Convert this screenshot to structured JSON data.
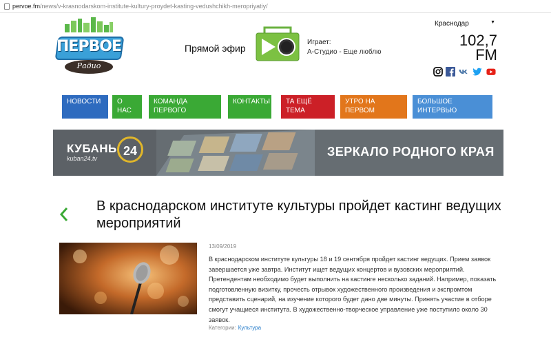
{
  "browser": {
    "host": "pervoe.fm",
    "path": "/news/v-krasnodarskom-institute-kultury-proydet-kasting-vedushchikh-meropriyatiy/"
  },
  "logo": {
    "brand": "ПЕРВОЕ",
    "sub": "Радио"
  },
  "live": {
    "label": "Прямой эфир"
  },
  "now_playing": {
    "label": "Играет:",
    "track": "А-Студио - Еще люблю"
  },
  "city": {
    "selected": "Краснодар"
  },
  "frequency": {
    "value": "102,7",
    "unit": "FM"
  },
  "socials": [
    {
      "icon": "instagram-icon"
    },
    {
      "icon": "facebook-icon"
    },
    {
      "icon": "vk-icon"
    },
    {
      "icon": "twitter-icon"
    },
    {
      "icon": "youtube-icon"
    }
  ],
  "nav": [
    {
      "label": "НОВОСТИ",
      "color": "#2e6bbf"
    },
    {
      "label": "О НАС",
      "color": "#3aa935"
    },
    {
      "label": "КОМАНДА ПЕРВОГО",
      "color": "#3aa935"
    },
    {
      "label": "КОНТАКТЫ",
      "color": "#3aa935"
    },
    {
      "label": "ТА ЕЩЁ ТЕМА",
      "color": "#cc2027"
    },
    {
      "label": "УТРО НА ПЕРВОМ",
      "color": "#e2761b"
    },
    {
      "label": "БОЛЬШОЕ ИНТЕРВЬЮ",
      "color": "#4a8fd6"
    }
  ],
  "banner": {
    "brand": "КУБАНЬ",
    "number": "24",
    "site": "kuban24.tv",
    "slogan": "ЗЕРКАЛО РОДНОГО КРАЯ"
  },
  "article": {
    "title": "В краснодарском институте культуры пройдет кастинг ведущих мероприятий",
    "date": "13/09/2019",
    "body": "В краснодарском институте культуры 18 и 19 сентября пройдет кастинг ведущих. Прием заявок завершается уже завтра. Институт ищет ведущих концертов и вузовских мероприятий. Претендентам необходимо будет выполнить на кастинге несколько заданий. Например, показать подготовленную визитку, прочесть отрывок художественного произведения и экспромтом представить сценарий, на изучение которого будет дано две минуты. Принять участие в отборе смогут учащиеся  института. В художественно-творческое управление уже поступило около 30 заявок.",
    "categories_label": "Категории:",
    "category": "Культура"
  },
  "colors": {
    "accent_green": "#3aa935",
    "link_blue": "#1f78c8"
  }
}
